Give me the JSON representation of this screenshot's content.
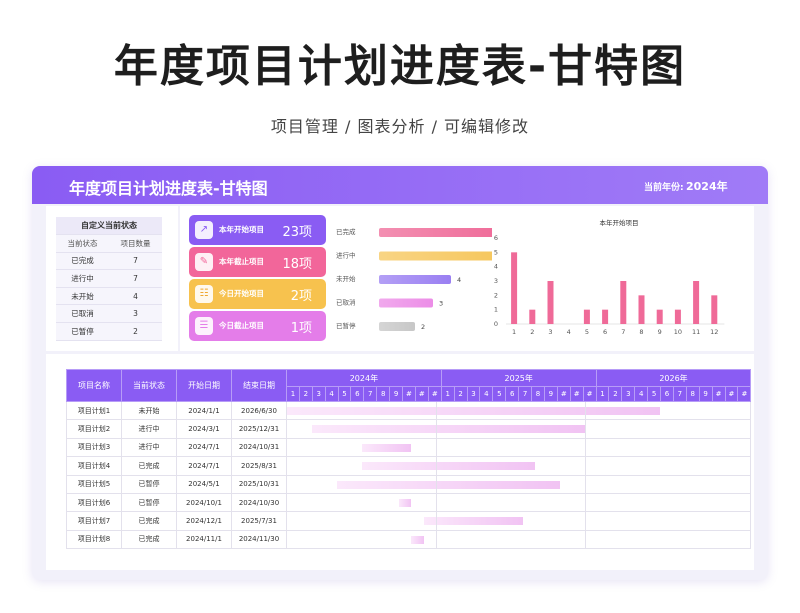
{
  "title": "年度项目计划进度表-甘特图",
  "subtitle": "项目管理 / 图表分析 / 可编辑修改",
  "sheet": {
    "title": "年度项目计划进度表-甘特图",
    "year_label": "当前年份:",
    "year_value": "2024年"
  },
  "status_table": {
    "caption": "自定义当前状态",
    "headers": [
      "当前状态",
      "项目数量"
    ],
    "rows": [
      {
        "status": "已完成",
        "count": "7"
      },
      {
        "status": "进行中",
        "count": "7"
      },
      {
        "status": "未开始",
        "count": "4"
      },
      {
        "status": "已取消",
        "count": "3"
      },
      {
        "status": "已暂停",
        "count": "2"
      }
    ]
  },
  "cards": [
    {
      "label": "本年开始项目",
      "value": "23项",
      "icon": "trend-up-icon",
      "color": "#8a5cf3"
    },
    {
      "label": "本年截止项目",
      "value": "18项",
      "icon": "clipboard-icon",
      "color": "#f2669a"
    },
    {
      "label": "今日开始项目",
      "value": "2项",
      "icon": "meeting-icon",
      "color": "#f7c24e"
    },
    {
      "label": "今日截止项目",
      "value": "1项",
      "icon": "list-icon",
      "color": "#e47de9"
    }
  ],
  "chart_data": [
    {
      "type": "bar",
      "orientation": "horizontal",
      "categories": [
        "已完成",
        "进行中",
        "未开始",
        "已取消",
        "已暂停"
      ],
      "values": [
        7,
        7,
        4,
        3,
        2
      ],
      "colors": [
        "#ef6a98",
        "#f6c65b",
        "#9a7ff2",
        "#ec8de7",
        "#c7c7c7"
      ],
      "xlim": [
        0,
        7
      ]
    },
    {
      "type": "bar",
      "title": "本年开始项目",
      "categories": [
        "1",
        "2",
        "3",
        "4",
        "5",
        "6",
        "7",
        "8",
        "9",
        "10",
        "11",
        "12"
      ],
      "values": [
        5,
        1,
        3,
        0,
        1,
        1,
        3,
        2,
        1,
        1,
        3,
        2
      ],
      "yticks": [
        "0",
        "1",
        "2",
        "3",
        "4",
        "5",
        "6"
      ],
      "ylim": [
        0,
        6
      ],
      "color": "#ef6a98"
    }
  ],
  "gantt": {
    "headers": [
      "项目名称",
      "当前状态",
      "开始日期",
      "结束日期"
    ],
    "years": [
      "2024年",
      "2025年",
      "2026年"
    ],
    "month_labels": [
      "1",
      "2",
      "3",
      "4",
      "5",
      "6",
      "7",
      "8",
      "9",
      "#",
      "#",
      "#",
      "1",
      "2",
      "3",
      "4",
      "5",
      "6",
      "7",
      "8",
      "9",
      "#",
      "#",
      "#",
      "1",
      "2",
      "3",
      "4",
      "5",
      "6",
      "7",
      "8",
      "9",
      "#",
      "#",
      "#"
    ],
    "rows": [
      {
        "name": "项目计划1",
        "status": "未开始",
        "start": "2024/1/1",
        "end": "2026/6/30",
        "s": 0,
        "e": 30
      },
      {
        "name": "项目计划2",
        "status": "进行中",
        "start": "2024/3/1",
        "end": "2025/12/31",
        "s": 2,
        "e": 24
      },
      {
        "name": "项目计划3",
        "status": "进行中",
        "start": "2024/7/1",
        "end": "2024/10/31",
        "s": 6,
        "e": 10
      },
      {
        "name": "项目计划4",
        "status": "已完成",
        "start": "2024/7/1",
        "end": "2025/8/31",
        "s": 6,
        "e": 20
      },
      {
        "name": "项目计划5",
        "status": "已暂停",
        "start": "2024/5/1",
        "end": "2025/10/31",
        "s": 4,
        "e": 22
      },
      {
        "name": "项目计划6",
        "status": "已暂停",
        "start": "2024/10/1",
        "end": "2024/10/30",
        "s": 9,
        "e": 10
      },
      {
        "name": "项目计划7",
        "status": "已完成",
        "start": "2024/12/1",
        "end": "2025/7/31",
        "s": 11,
        "e": 19
      },
      {
        "name": "项目计划8",
        "status": "已完成",
        "start": "2024/11/1",
        "end": "2024/11/30",
        "s": 10,
        "e": 11
      }
    ]
  }
}
